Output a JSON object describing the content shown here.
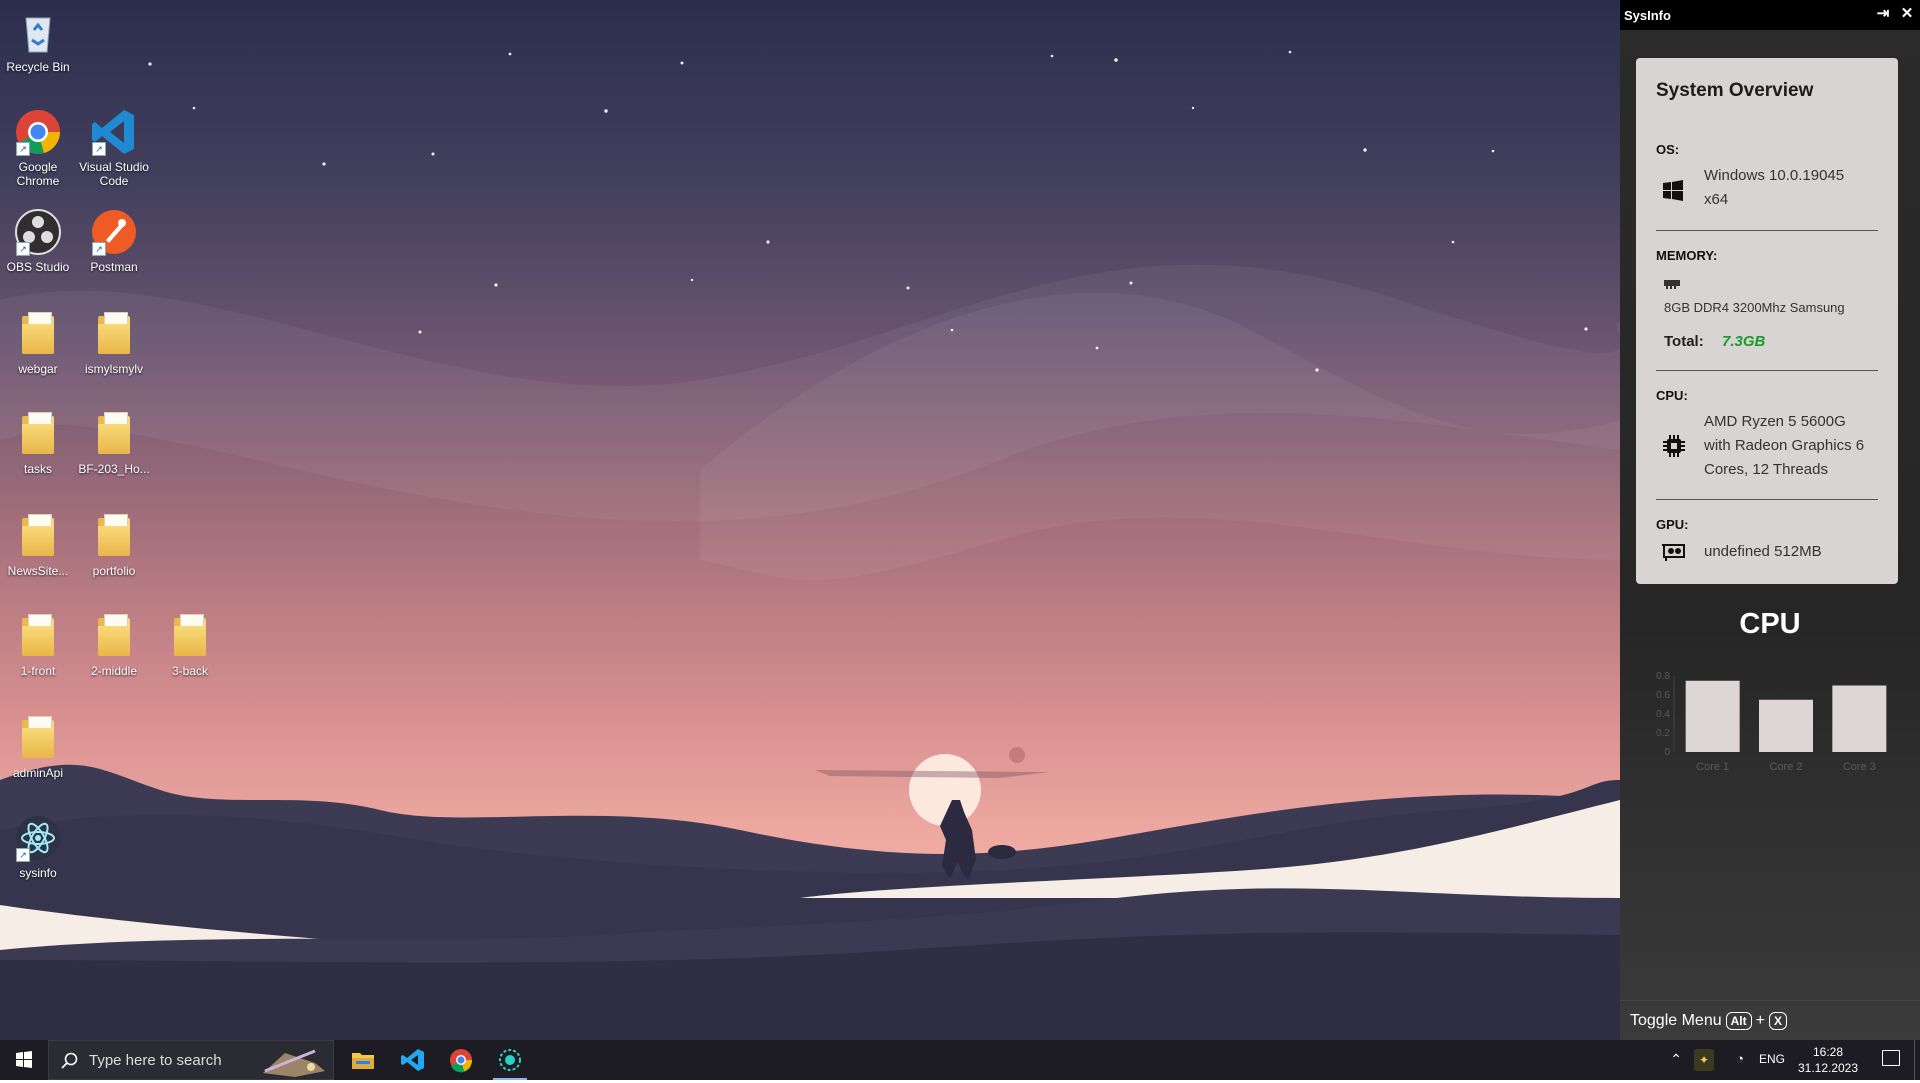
{
  "desktop": {
    "icons": [
      {
        "label": "Recycle Bin",
        "icon": "recycle-bin-icon"
      },
      {
        "label": "Google Chrome",
        "icon": "chrome-icon"
      },
      {
        "label": "Visual Studio Code",
        "icon": "vscode-icon"
      },
      {
        "label": "OBS Studio",
        "icon": "obs-icon"
      },
      {
        "label": "Postman",
        "icon": "postman-icon"
      },
      {
        "label": "webgar",
        "icon": "folder-icon"
      },
      {
        "label": "ismylsmylv",
        "icon": "folder-icon"
      },
      {
        "label": "tasks",
        "icon": "folder-icon"
      },
      {
        "label": "BF-203_Ho...",
        "icon": "folder-icon"
      },
      {
        "label": "NewsSite...",
        "icon": "folder-icon"
      },
      {
        "label": "portfolio",
        "icon": "folder-icon"
      },
      {
        "label": "1-front",
        "icon": "folder-icon"
      },
      {
        "label": "2-middle",
        "icon": "folder-icon"
      },
      {
        "label": "3-back",
        "icon": "folder-icon"
      },
      {
        "label": "adminApi",
        "icon": "folder-icon"
      },
      {
        "label": "sysinfo",
        "icon": "electron-icon"
      }
    ]
  },
  "sysinfo": {
    "window_title": "SysInfo",
    "card": {
      "title": "System Overview",
      "os_label": "OS:",
      "os_line1": "Windows 10.0.19045",
      "os_line2": "x64",
      "memory_label": "MEMORY:",
      "memory_module": "8GB DDR4 3200Mhz Samsung",
      "memory_total_label": "Total:",
      "memory_total_value": "7.3GB",
      "cpu_label": "CPU:",
      "cpu_line1": "AMD Ryzen 5 5600G",
      "cpu_line2": "with Radeon Graphics 6",
      "cpu_line3": "Cores, 12 Threads",
      "gpu_label": "GPU:",
      "gpu_value": "undefined 512MB"
    },
    "cpu_title": "CPU",
    "toggle_menu": {
      "label": "Toggle Menu",
      "key1": "Alt",
      "plus": "+",
      "key2": "X"
    }
  },
  "chart_data": {
    "type": "bar",
    "categories": [
      "Core 1",
      "Core 2",
      "Core 3"
    ],
    "values": [
      0.75,
      0.55,
      0.7
    ],
    "yticks": [
      "0",
      "0.2",
      "0.4",
      "0.6",
      "0.8"
    ],
    "ylim": [
      0,
      0.8
    ],
    "bar_color": "#dcd6d6"
  },
  "taskbar": {
    "search_placeholder": "Type here to search",
    "language": "ENG",
    "time": "16:28",
    "date": "31.12.2023",
    "apps": [
      "file-explorer-icon",
      "vscode-icon",
      "chrome-icon",
      "sysinfo-icon"
    ]
  },
  "colors": {
    "accent_green": "#1a9a2a",
    "taskbar": "#1c1c22",
    "card": "#d9d4d4"
  }
}
